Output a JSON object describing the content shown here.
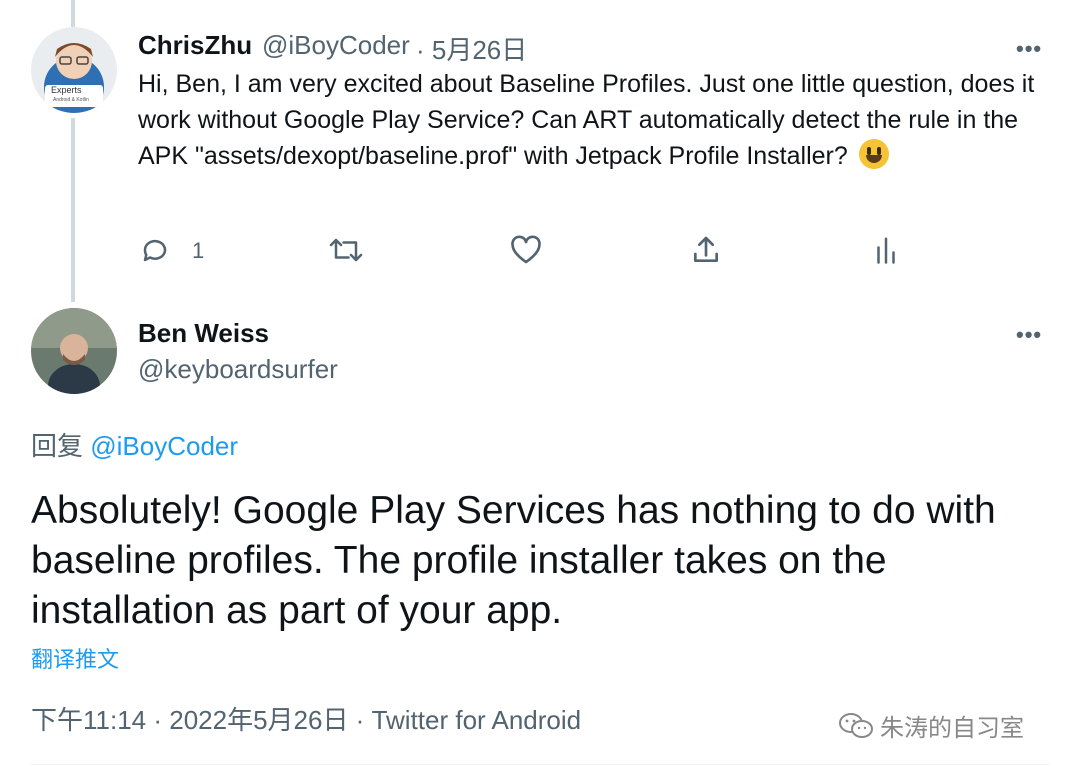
{
  "tweet1": {
    "name": "ChrisZhu",
    "handle": "@iBoyCoder",
    "date": "· 5月26日",
    "text": "Hi, Ben, I am very excited about Baseline Profiles. Just one little question, does it work without Google Play Service? Can ART automatically detect the rule in the APK \"assets/dexopt/baseline.prof\" with Jetpack Profile Installer?",
    "avatar_badge": "Experts",
    "avatar_sub": "Android & Kotlin",
    "reply_count": "1",
    "more": "•••"
  },
  "tweet2": {
    "name": "Ben Weiss",
    "handle": "@keyboardsurfer",
    "more": "•••",
    "replying_prefix": "回复",
    "replying_to": "@iBoyCoder",
    "text": "Absolutely! Google Play Services has nothing to do with baseline profiles. The profile installer takes on the installation as part of your app.",
    "translate": "翻译推文",
    "meta": "下午11:14 · 2022年5月26日 · Twitter for Android"
  },
  "watermark": "朱涛的自习室",
  "colors": {
    "accent": "#1d9bf0",
    "secondary": "#536471",
    "text": "#0f1419"
  },
  "icons": [
    "reply-icon",
    "retweet-icon",
    "like-icon",
    "share-icon",
    "analytics-icon",
    "more-icon",
    "wechat-icon"
  ]
}
